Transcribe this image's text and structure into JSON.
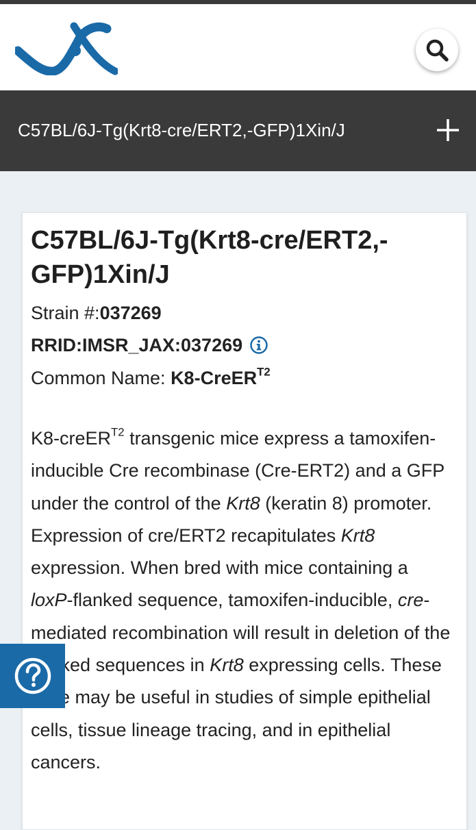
{
  "header": {
    "logo_alt": "JAX",
    "search_icon": "search-icon"
  },
  "titlebar": {
    "title": "C57BL/6J-Tg(Krt8-cre/ERT2,-GFP)1Xin/J",
    "expand_icon": "plus-icon"
  },
  "strain": {
    "title": "C57BL/6J-Tg(Krt8-cre/ERT2,-GFP)1Xin/J",
    "strain_label": "Strain #:",
    "strain_number": "037269",
    "rrid": "RRID:IMSR_JAX:037269",
    "common_name_label": "Common Name: ",
    "common_name": "K8-CreER",
    "common_name_sup": "T2"
  },
  "description": {
    "s1": "K8-creER",
    "s1_sup": "T2",
    "s2": " transgenic mice express a tamoxifen-inducible Cre recombinase (Cre-ERT2) and a GFP under the control of the ",
    "s3_italic": "Krt8",
    "s4": " (keratin 8) promoter. Expression of cre/ERT2 recapitulates ",
    "s5_italic": "Krt8",
    "s6": " expression. When bred with mice containing a ",
    "s7_italic": "loxP",
    "s8": "-flanked sequence, tamoxifen-inducible, ",
    "s9_italic": "cre",
    "s10": "-mediated recombination will result in deletion of the flanked sequences in ",
    "s11_italic": "Krt8",
    "s12": " expressing cells. These mice may be useful in studies of simple epithelial cells, tissue lineage tracing, and in epithelial cancers."
  },
  "help": {
    "icon": "help-icon"
  },
  "colors": {
    "brand_blue": "#1a6aa8",
    "dark_bar": "#3a3a3a",
    "page_bg": "#eaf0f4"
  }
}
